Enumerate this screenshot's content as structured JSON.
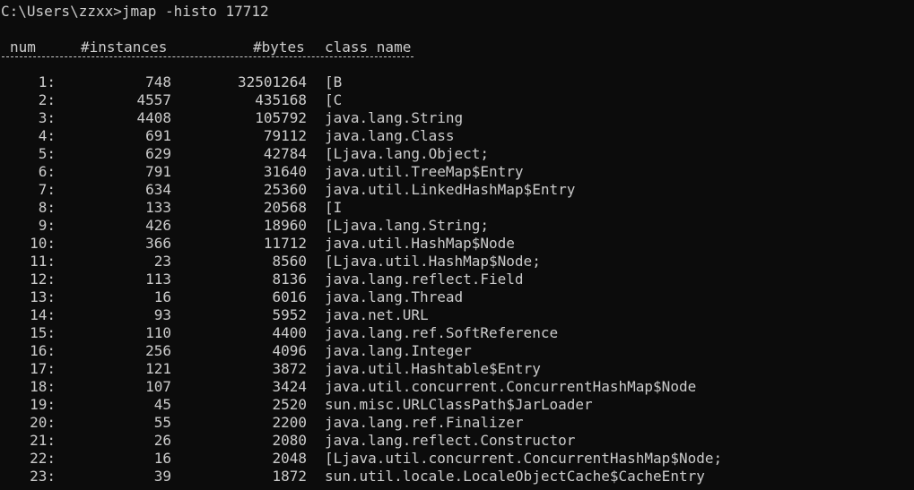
{
  "terminal": {
    "prompt": "C:\\Users\\zzxx>",
    "command": "jmap -histo 17712"
  },
  "table": {
    "headers": {
      "num": "num",
      "instances": "#instances",
      "bytes": "#bytes",
      "class_name": "class name"
    },
    "rows": [
      {
        "num": "1:",
        "instances": "748",
        "bytes": "32501264",
        "class_name": "[B"
      },
      {
        "num": "2:",
        "instances": "4557",
        "bytes": "435168",
        "class_name": "[C"
      },
      {
        "num": "3:",
        "instances": "4408",
        "bytes": "105792",
        "class_name": "java.lang.String"
      },
      {
        "num": "4:",
        "instances": "691",
        "bytes": "79112",
        "class_name": "java.lang.Class"
      },
      {
        "num": "5:",
        "instances": "629",
        "bytes": "42784",
        "class_name": "[Ljava.lang.Object;"
      },
      {
        "num": "6:",
        "instances": "791",
        "bytes": "31640",
        "class_name": "java.util.TreeMap$Entry"
      },
      {
        "num": "7:",
        "instances": "634",
        "bytes": "25360",
        "class_name": "java.util.LinkedHashMap$Entry"
      },
      {
        "num": "8:",
        "instances": "133",
        "bytes": "20568",
        "class_name": "[I"
      },
      {
        "num": "9:",
        "instances": "426",
        "bytes": "18960",
        "class_name": "[Ljava.lang.String;"
      },
      {
        "num": "10:",
        "instances": "366",
        "bytes": "11712",
        "class_name": "java.util.HashMap$Node"
      },
      {
        "num": "11:",
        "instances": "23",
        "bytes": "8560",
        "class_name": "[Ljava.util.HashMap$Node;"
      },
      {
        "num": "12:",
        "instances": "113",
        "bytes": "8136",
        "class_name": "java.lang.reflect.Field"
      },
      {
        "num": "13:",
        "instances": "16",
        "bytes": "6016",
        "class_name": "java.lang.Thread"
      },
      {
        "num": "14:",
        "instances": "93",
        "bytes": "5952",
        "class_name": "java.net.URL"
      },
      {
        "num": "15:",
        "instances": "110",
        "bytes": "4400",
        "class_name": "java.lang.ref.SoftReference"
      },
      {
        "num": "16:",
        "instances": "256",
        "bytes": "4096",
        "class_name": "java.lang.Integer"
      },
      {
        "num": "17:",
        "instances": "121",
        "bytes": "3872",
        "class_name": "java.util.Hashtable$Entry"
      },
      {
        "num": "18:",
        "instances": "107",
        "bytes": "3424",
        "class_name": "java.util.concurrent.ConcurrentHashMap$Node"
      },
      {
        "num": "19:",
        "instances": "45",
        "bytes": "2520",
        "class_name": "sun.misc.URLClassPath$JarLoader"
      },
      {
        "num": "20:",
        "instances": "55",
        "bytes": "2200",
        "class_name": "java.lang.ref.Finalizer"
      },
      {
        "num": "21:",
        "instances": "26",
        "bytes": "2080",
        "class_name": "java.lang.reflect.Constructor"
      },
      {
        "num": "22:",
        "instances": "16",
        "bytes": "2048",
        "class_name": "[Ljava.util.concurrent.ConcurrentHashMap$Node;"
      },
      {
        "num": "23:",
        "instances": "39",
        "bytes": "1872",
        "class_name": "sun.util.locale.LocaleObjectCache$CacheEntry"
      }
    ]
  },
  "colors": {
    "background": "#0c0c0c",
    "foreground": "#cccccc"
  }
}
